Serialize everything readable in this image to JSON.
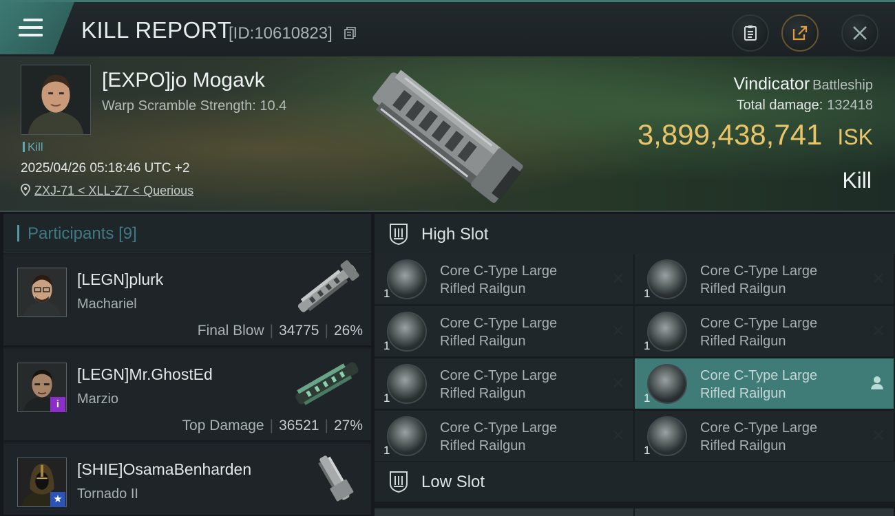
{
  "header": {
    "title": "KILL REPORT",
    "report_id": "[ID:10610823]",
    "icons": [
      "menu-icon",
      "copy-icon",
      "clipboard-icon",
      "share-icon",
      "close-icon"
    ]
  },
  "victim": {
    "name": "[EXPO]jo Mogavk",
    "warp_scramble": "Warp Scramble Strength: 10.4",
    "tag": "Kill",
    "datetime": "2025/04/26 05:18:46 UTC +2",
    "location": "ZXJ-71 < XLL-Z7 < Querious",
    "ship": "Vindicator",
    "ship_class": "Battleship",
    "total_damage_label": "Total damage:",
    "total_damage": "132418",
    "isk_value": "3,899,438,741",
    "isk_unit": "ISK",
    "result": "Kill"
  },
  "participants": {
    "title": "Participants",
    "count": "[9]",
    "items": [
      {
        "name": "[LEGN]plurk",
        "ship": "Machariel",
        "label": "Final Blow",
        "damage": "34775",
        "percent": "26%"
      },
      {
        "name": "[LEGN]Mr.GhostEd",
        "ship": "Marzio",
        "label": "Top Damage",
        "damage": "36521",
        "percent": "27%",
        "badge": "i"
      },
      {
        "name": "[SHIE]OsamaBenharden",
        "ship": "Tornado II",
        "badge": "★"
      }
    ]
  },
  "slots": {
    "high_title": "High Slot",
    "low_title": "Low Slot",
    "module_name": [
      "Core C-Type Large",
      "Rifled Railgun"
    ],
    "modules": [
      {
        "l1": "Core C-Type Large",
        "l2": "Rifled Railgun",
        "qty": "1",
        "status": "destroyed"
      },
      {
        "l1": "Core C-Type Large",
        "l2": "Rifled Railgun",
        "qty": "1",
        "status": "destroyed"
      },
      {
        "l1": "Core C-Type Large",
        "l2": "Rifled Railgun",
        "qty": "1",
        "status": "destroyed"
      },
      {
        "l1": "Core C-Type Large",
        "l2": "Rifled Railgun",
        "qty": "1",
        "status": "destroyed"
      },
      {
        "l1": "Core C-Type Large",
        "l2": "Rifled Railgun",
        "qty": "1",
        "status": "destroyed"
      },
      {
        "l1": "Core C-Type Large",
        "l2": "Rifled Railgun",
        "qty": "1",
        "status": "dropped"
      },
      {
        "l1": "Core C-Type Large",
        "l2": "Rifled Railgun",
        "qty": "1",
        "status": "destroyed"
      },
      {
        "l1": "Core C-Type Large",
        "l2": "Rifled Railgun",
        "qty": "1",
        "status": "destroyed"
      }
    ]
  },
  "colors": {
    "accent": "#3f7c78",
    "isk": "#e8c46a",
    "tag": "#63a9b5"
  }
}
